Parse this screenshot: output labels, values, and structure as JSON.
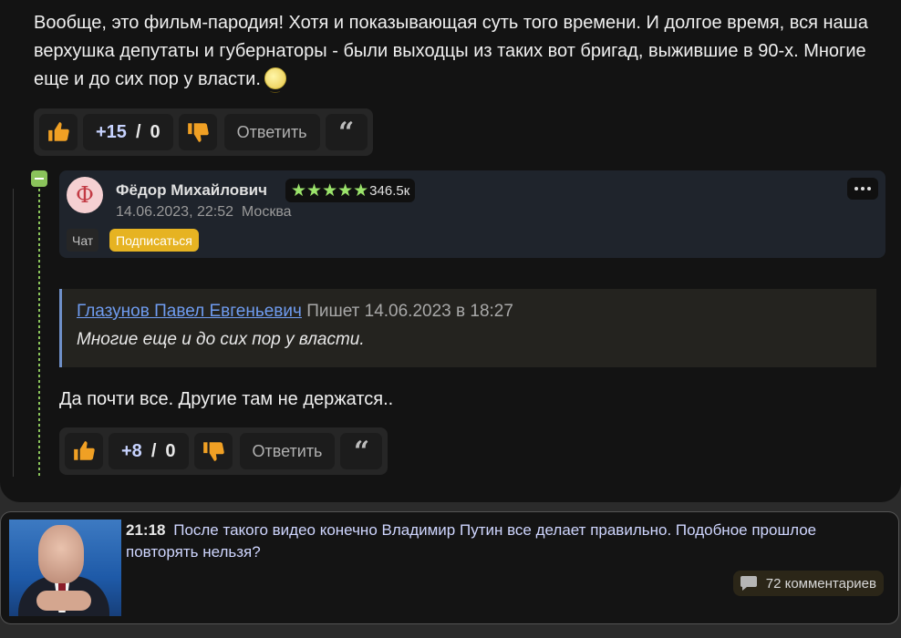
{
  "post": {
    "text": "Вообще, это фильм-пародия! Хотя и показывающая суть того времени. И долгое время, вся наша верхушка депутаты и губернаторы - были выходцы из таких вот бригад, выжившие в 90-х. Многие еще и до сих пор у власти.",
    "emoji": "smiley-emoji",
    "votes": {
      "up": "+15",
      "sep": "/",
      "down": "0"
    },
    "reply_label": "Ответить",
    "quote_label": "“"
  },
  "reply": {
    "author_initial": "Ф",
    "author_name": "Фёдор Михайлович",
    "stars": "★★★★★",
    "rating": "346.5к",
    "date": "14.06.2023, 22:52",
    "location": "Москва",
    "chat_label": "Чат",
    "subscribe_label": "Подписаться",
    "quote": {
      "author": "Глазунов Павел Евгеньевич",
      "writes": "Пишет 14.06.2023 в 18:27",
      "text": "Многие еще и до сих пор у власти."
    },
    "text": "Да почти все. Другие там не держатся..",
    "votes": {
      "up": "+8",
      "sep": "/",
      "down": "0"
    },
    "reply_label": "Ответить",
    "quote_label": "“"
  },
  "news": {
    "time": "21:18",
    "title": "После такого видео конечно Владимир Путин все делает правильно. Подобное прошлое повторять нельзя?",
    "comments": "72 комментариев"
  },
  "colors": {
    "like": "#f0a024",
    "dislike": "#f0a024",
    "collapse": "#8ac35b",
    "link": "#6f9cf0",
    "subscribe": "#e6b322"
  }
}
